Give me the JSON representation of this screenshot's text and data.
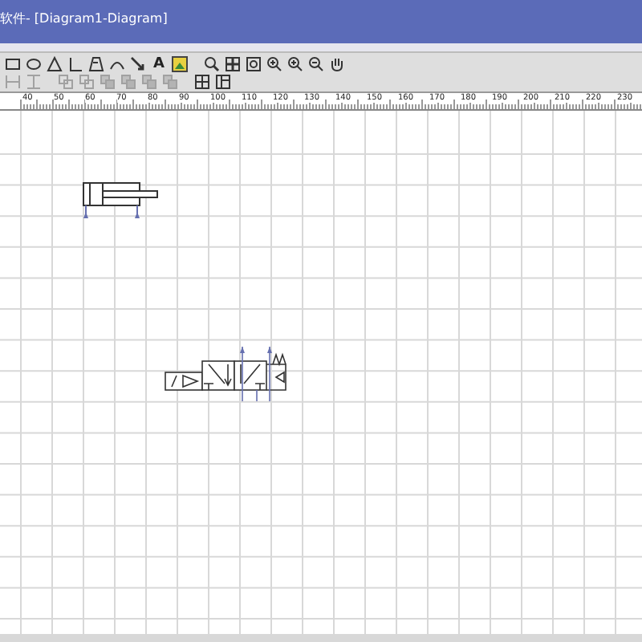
{
  "window": {
    "title": "软件- [Diagram1-Diagram]"
  },
  "toolbar_rows": [
    [
      {
        "kind": "rectangle",
        "disabled": false
      },
      {
        "kind": "ellipse",
        "disabled": false
      },
      {
        "kind": "triangle",
        "disabled": false
      },
      {
        "kind": "line",
        "disabled": false
      },
      {
        "kind": "polygon",
        "disabled": false
      },
      {
        "kind": "arc",
        "disabled": false
      },
      {
        "kind": "arrow",
        "disabled": false
      },
      {
        "kind": "text",
        "label": "A",
        "disabled": false
      },
      {
        "kind": "image",
        "disabled": false
      },
      {
        "kind": "separator"
      },
      {
        "kind": "zoom",
        "disabled": false
      },
      {
        "kind": "fit",
        "disabled": false
      },
      {
        "kind": "zoom-area",
        "disabled": false
      },
      {
        "kind": "zoom-in",
        "disabled": false
      },
      {
        "kind": "zoom-in",
        "disabled": false
      },
      {
        "kind": "zoom-out",
        "disabled": false
      },
      {
        "kind": "pan",
        "disabled": false
      }
    ],
    [
      {
        "kind": "align-h",
        "disabled": true
      },
      {
        "kind": "align-v",
        "disabled": true
      },
      {
        "kind": "separator"
      },
      {
        "kind": "same-size",
        "disabled": true
      },
      {
        "kind": "same-size",
        "disabled": true
      },
      {
        "kind": "layer",
        "disabled": true
      },
      {
        "kind": "layer",
        "disabled": true
      },
      {
        "kind": "layer",
        "disabled": true
      },
      {
        "kind": "layer",
        "disabled": true
      },
      {
        "kind": "separator"
      },
      {
        "kind": "grid",
        "disabled": false
      },
      {
        "kind": "grid-split",
        "disabled": false
      }
    ]
  ],
  "ruler": {
    "labels": [
      "40",
      "50",
      "60",
      "70",
      "80",
      "90",
      "100",
      "110",
      "120",
      "130",
      "140",
      "150",
      "160",
      "170",
      "180",
      "190",
      "200",
      "210",
      "220",
      "230"
    ]
  },
  "canvas": {
    "components": [
      {
        "kind": "cylinder"
      },
      {
        "kind": "valve"
      }
    ]
  }
}
